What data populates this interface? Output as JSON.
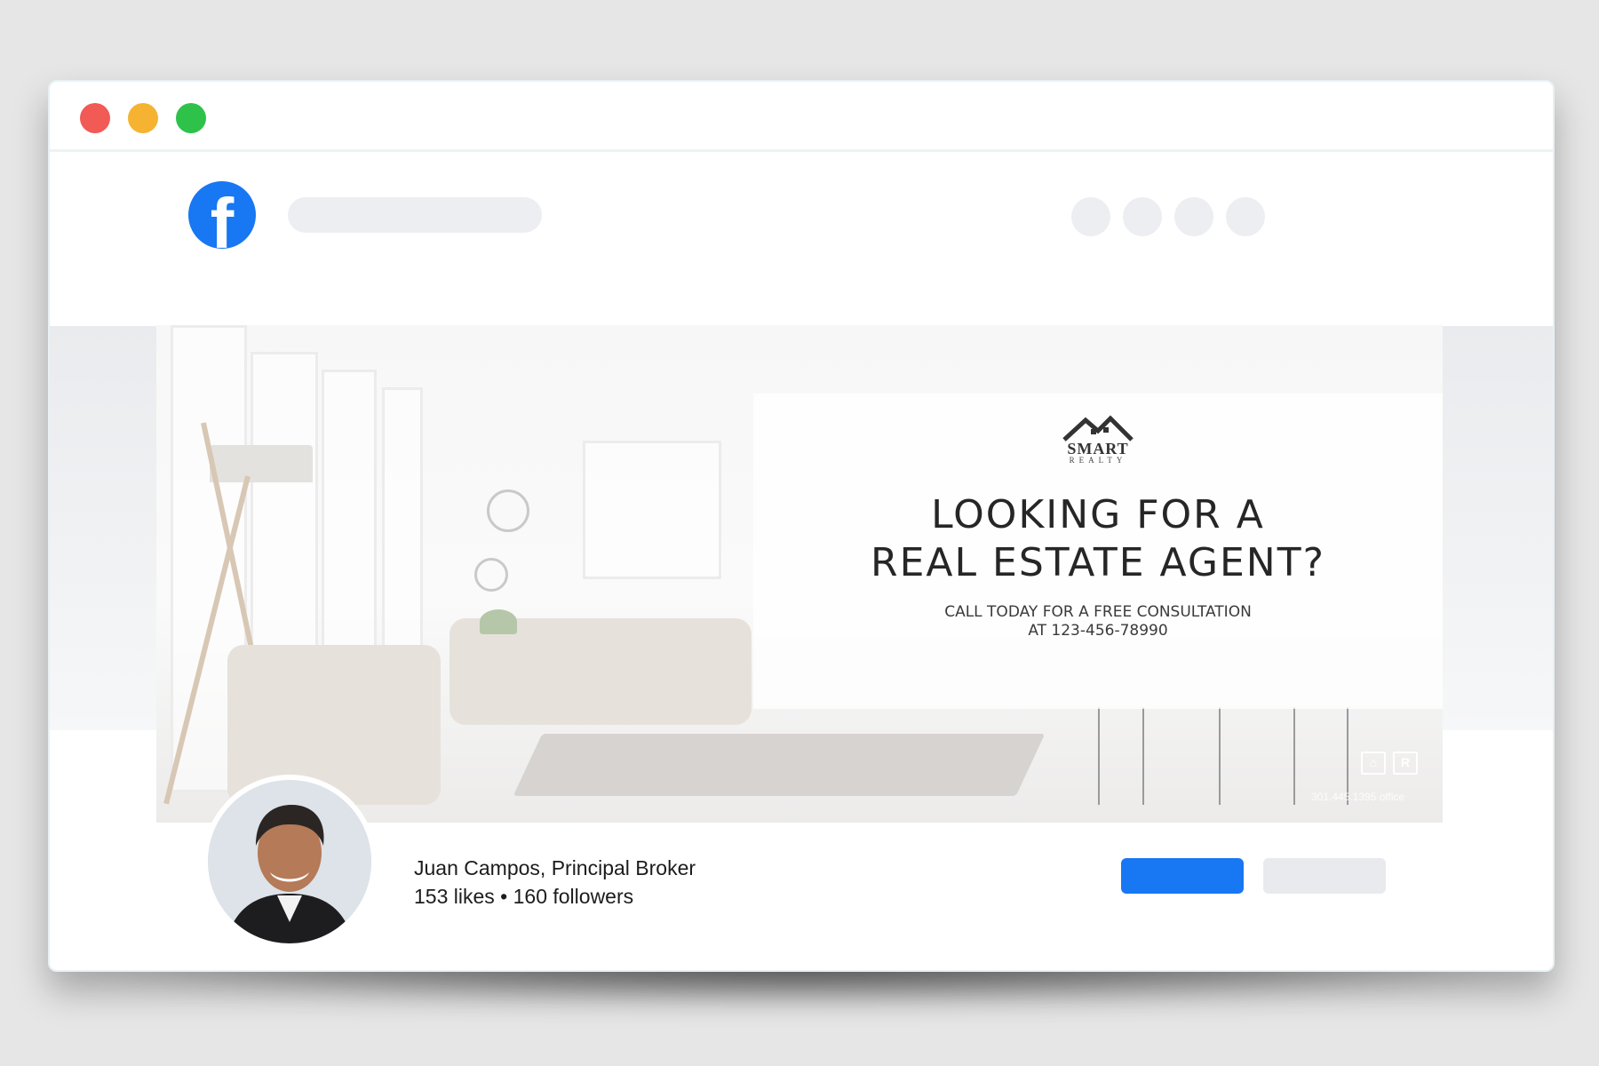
{
  "browser": {
    "traffic_lights": [
      "close",
      "minimize",
      "maximize"
    ]
  },
  "facebook": {
    "logo_letter": "f",
    "brand_color": "#1877f2"
  },
  "cover": {
    "logo_name": "SMART",
    "logo_tagline": "REALTY",
    "headline_line1": "LOOKING FOR A",
    "headline_line2": "REAL ESTATE AGENT?",
    "cta_line1": "CALL TODAY FOR A FREE CONSULTATION",
    "cta_line2": "AT 123-456-78990",
    "equal_housing_icon": "⌂",
    "realtor_icon": "R",
    "office_phone": "301.445.1395 office"
  },
  "profile": {
    "name": "Juan Campos, Principal Broker",
    "stats": "153 likes • 160 followers"
  },
  "colors": {
    "accent": "#1877f2",
    "placeholder": "#eceef1",
    "red": "#f25a55",
    "yellow": "#f5b331",
    "green": "#2fc24b"
  }
}
